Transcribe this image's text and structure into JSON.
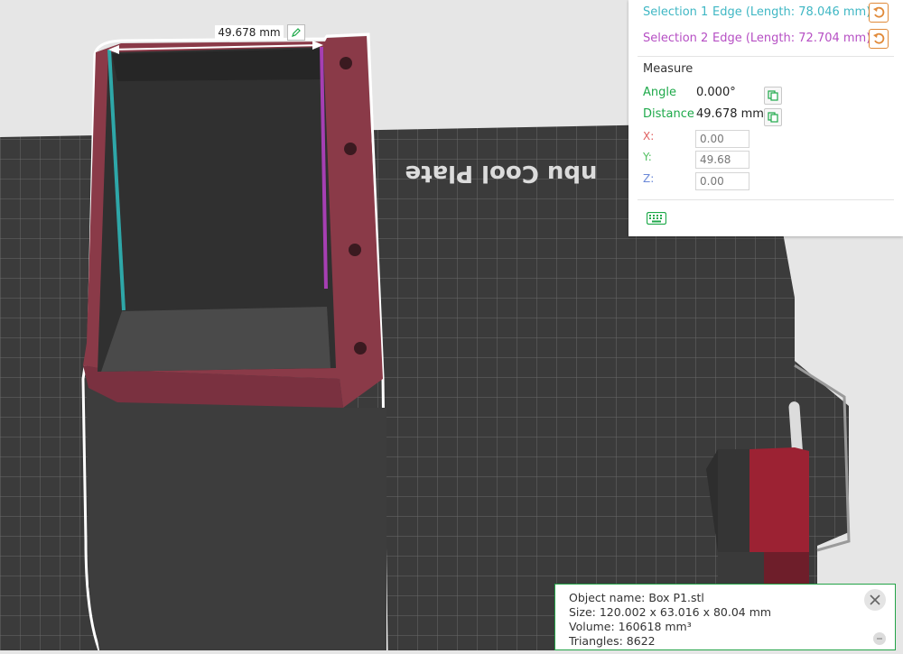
{
  "measure_panel": {
    "selection1": {
      "name": "Selection 1",
      "description": "Edge (Length: 78.046 mm)"
    },
    "selection2": {
      "name": "Selection 2",
      "description": "Edge (Length: 72.704 mm)"
    },
    "title": "Measure",
    "angle": {
      "label": "Angle",
      "value": "0.000°"
    },
    "distance": {
      "label": "Distance",
      "value": "49.678 mm"
    },
    "x": {
      "label": "X:",
      "value": "0.00"
    },
    "y": {
      "label": "Y:",
      "value": "49.68"
    },
    "z": {
      "label": "Z:",
      "value": "0.00"
    }
  },
  "viewport": {
    "dimension_label": "49.678 mm",
    "plate_text": "nbu Cool Plate"
  },
  "object_info": {
    "name_line": "Object name: Box P1.stl",
    "size_line": "Size: 120.002 x 63.016 x 80.04 mm",
    "volume_line": "Volume: 160618 mm³",
    "triangles_line": "Triangles: 8622"
  },
  "colors": {
    "selection1": "#3fb7c4",
    "selection2": "#b64fc4",
    "accent_green": "#1ea94a",
    "reset_orange": "#e08a3a",
    "model_red": "#8a3a48",
    "model_dark": "#3b3b3b",
    "bed": "#3a3a3a"
  },
  "icons": {
    "reset": "reset-icon",
    "copy": "copy-icon",
    "edit": "pencil-icon",
    "keyboard": "keyboard-icon",
    "close": "close-icon"
  }
}
